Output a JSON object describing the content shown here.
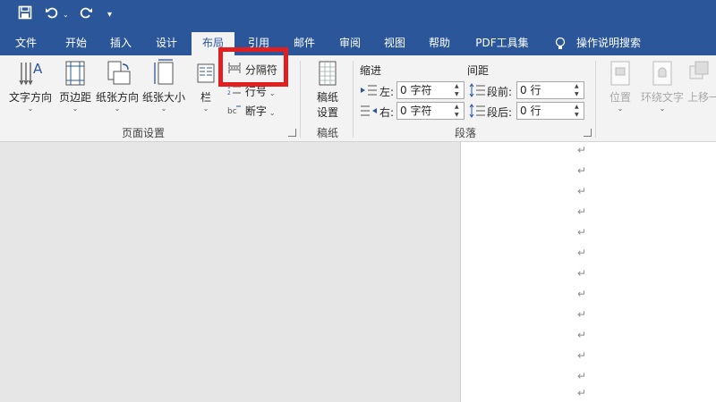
{
  "qat": {
    "save_icon": "save-icon",
    "undo_icon": "undo-icon",
    "redo_icon": "redo-icon",
    "customize_icon": "customize-qat-icon"
  },
  "tabs": [
    {
      "label": "文件"
    },
    {
      "label": "开始"
    },
    {
      "label": "插入"
    },
    {
      "label": "设计"
    },
    {
      "label": "布局"
    },
    {
      "label": "引用"
    },
    {
      "label": "邮件"
    },
    {
      "label": "审阅"
    },
    {
      "label": "视图"
    },
    {
      "label": "帮助"
    },
    {
      "label": "PDF工具集"
    }
  ],
  "tell_me": {
    "label": "操作说明搜索",
    "icon": "lightbulb-icon"
  },
  "page_setup": {
    "group_label": "页面设置",
    "text_direction": "文字方向",
    "margins": "页边距",
    "orientation": "纸张方向",
    "size": "纸张大小",
    "columns": "栏",
    "breaks": "分隔符",
    "line_numbers": "行号",
    "hyphenation": "断字"
  },
  "draft_paper": {
    "group_label": "稿纸",
    "button_line1": "稿纸",
    "button_line2": "设置"
  },
  "paragraph": {
    "group_label": "段落",
    "indent_title": "缩进",
    "spacing_title": "间距",
    "left_label": "左:",
    "right_label": "右:",
    "before_label": "段前:",
    "after_label": "段后:",
    "left_value": "0 字符",
    "right_value": "0 字符",
    "before_value": "0 行",
    "after_value": "0 行"
  },
  "arrange": {
    "position": "位置",
    "wrap_text": "环绕文字",
    "bring_forward": "上移一"
  },
  "document": {
    "paragraph_mark": "↵"
  },
  "colors": {
    "accent": "#2b579a",
    "highlight": "#e02020"
  }
}
